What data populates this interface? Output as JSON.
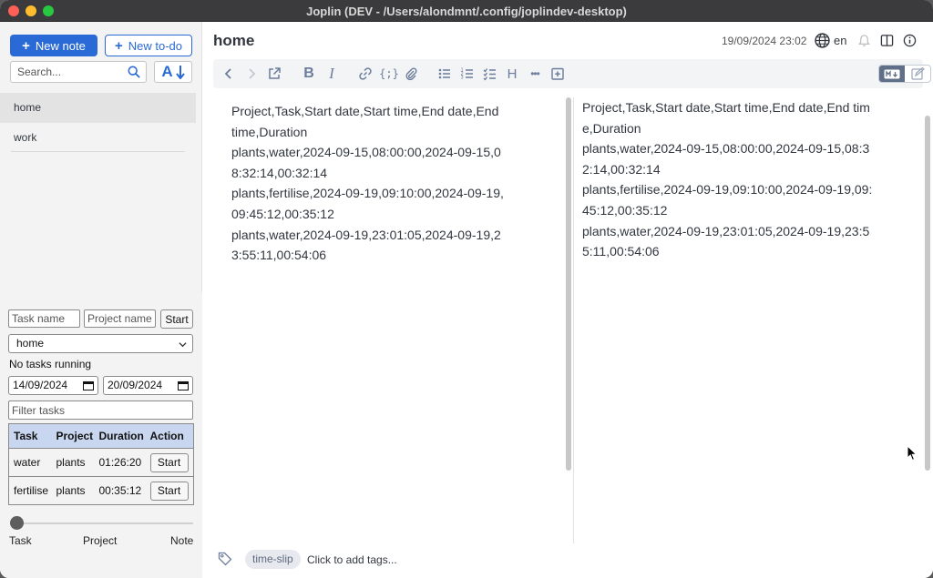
{
  "window": {
    "title": "Joplin (DEV - /Users/alondmnt/.config/joplindev-desktop)"
  },
  "sidebar": {
    "new_note_label": "New note",
    "new_todo_label": "New to-do",
    "search_placeholder": "Search...",
    "notes": [
      {
        "title": "home",
        "selected": true
      },
      {
        "title": "work",
        "selected": false
      }
    ]
  },
  "tracker": {
    "task_name_placeholder": "Task name",
    "project_name_placeholder": "Project name",
    "start_label": "Start",
    "note_select_value": "home",
    "status": "No tasks running",
    "date_from": "14/09/2024",
    "date_to": "20/09/2024",
    "filter_placeholder": "Filter tasks",
    "table": {
      "headers": [
        "Task",
        "Project",
        "Duration",
        "Action"
      ],
      "rows": [
        {
          "task": "water",
          "project": "plants",
          "duration": "01:26:20",
          "action": "Start"
        },
        {
          "task": "fertilise",
          "project": "plants",
          "duration": "00:35:12",
          "action": "Start"
        }
      ]
    },
    "group_by": {
      "options": [
        "Task",
        "Project",
        "Note"
      ],
      "selected": "Task"
    }
  },
  "note": {
    "title": "home",
    "updated": "19/09/2024 23:02",
    "language": "en",
    "editor_text": "Project,Task,Start date,Start time,End date,End time,Duration\nplants,water,2024-09-15,08:00:00,2024-09-15,08:32:14,00:32:14\nplants,fertilise,2024-09-19,09:10:00,2024-09-19,09:45:12,00:35:12\nplants,water,2024-09-19,23:01:05,2024-09-19,23:55:11,00:54:06",
    "viewer_text": "Project,Task,Start date,Start time,End date,End time,Duration\nplants,water,2024-09-15,08:00:00,2024-09-15,08:32:14,00:32:14\nplants,fertilise,2024-09-19,09:10:00,2024-09-19,09:45:12,00:35:12\nplants,water,2024-09-19,23:01:05,2024-09-19,23:55:11,00:54:06",
    "tags": [
      "time-slip"
    ],
    "add_tags_label": "Click to add tags..."
  },
  "toolbar": {
    "bold_label": "B",
    "italic_label": "I",
    "code_label": "{;}",
    "heading_label": "H",
    "more_label": "•••"
  },
  "colors": {
    "accent": "#2a6ad6",
    "table_header": "#c8d7ef",
    "toolbar_icon": "#6b7d9b"
  }
}
